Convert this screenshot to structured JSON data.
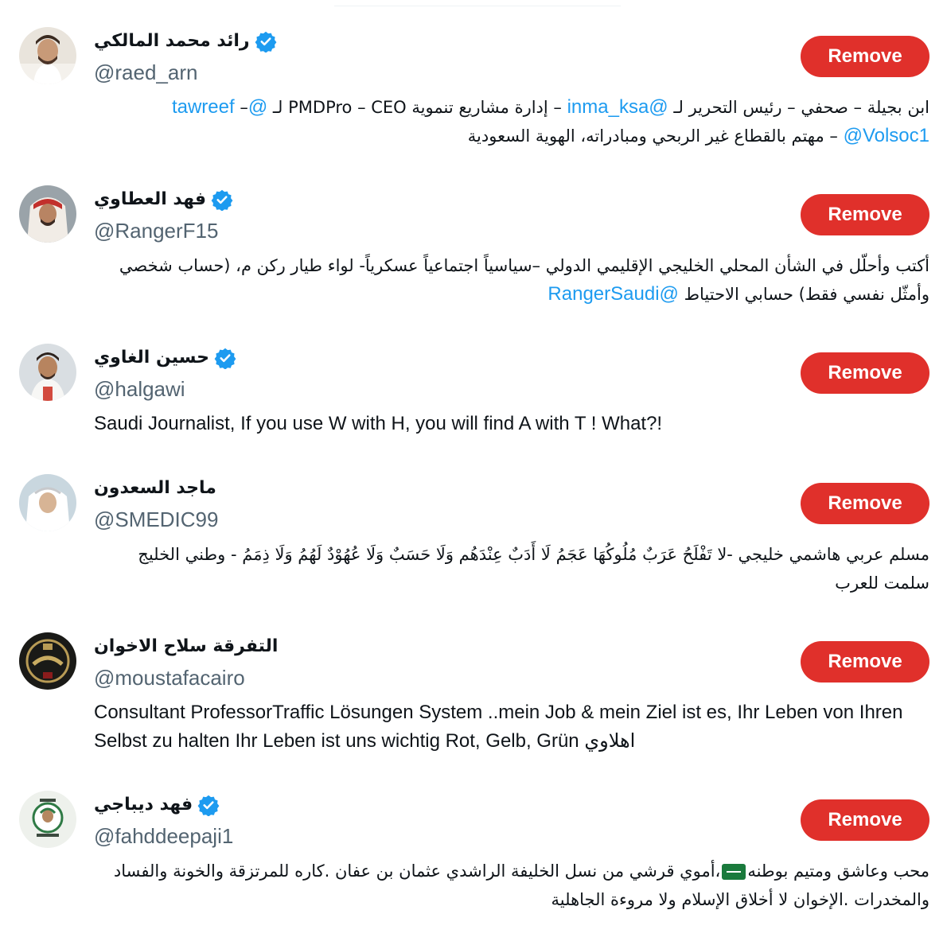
{
  "colors": {
    "remove_bg": "#e0302b",
    "mention": "#1d9bf0",
    "handle": "#536471",
    "verified": "#1d9bf0"
  },
  "users": [
    {
      "name": "رائد محمد المالكي",
      "verified": true,
      "handle": "@raed_arn",
      "remove_label": "Remove",
      "bio_dir": "rtl",
      "bio_parts": [
        {
          "t": "ابن بجيلة – صحفي – رئيس التحرير لـ "
        },
        {
          "t": "@inma_ksa",
          "m": true
        },
        {
          "t": " – إدارة مشاريع تنموية PMDPro – CEO لـ "
        },
        {
          "t": "@tawreef",
          "m": true
        },
        {
          "t": " – "
        },
        {
          "t": "@Volsoc1",
          "m": true
        },
        {
          "t": " – مهتم بالقطاع غير الربحي ومبادراته، الهوية السعودية"
        }
      ]
    },
    {
      "name": "فهد العطاوي",
      "verified": true,
      "handle": "@RangerF15",
      "remove_label": "Remove",
      "bio_dir": "rtl",
      "bio_parts": [
        {
          "t": "أكتب وأحلّل في الشأن المحلي الخليجي الإقليمي الدولي –سياسياً اجتماعياً عسكرياً- لواء طيار ركن م، (حساب شخصي وأمثّل نفسي فقط) حسابي الاحتياط "
        },
        {
          "t": "@RangerSaudi",
          "m": true
        }
      ]
    },
    {
      "name": "حسين الغاوي",
      "verified": true,
      "handle": "@halgawi",
      "remove_label": "Remove",
      "bio_dir": "ltr",
      "bio_parts": [
        {
          "t": "Saudi Journalist, If you use W with H, you will find A with T ! What?!"
        }
      ]
    },
    {
      "name": "ماجد السعدون",
      "verified": false,
      "handle": "@SMEDIC99",
      "remove_label": "Remove",
      "bio_dir": "rtl",
      "bio_parts": [
        {
          "t": "مسلم عربي هاشمي خليجي -لا تَفْلَحُ عَرَبٌ مُلُوكُهَا عَجَمُ لَا أَدَبٌ عِنْدَهُم وَلَا حَسَبٌ وَلَا عُهُوْدٌ لَهُمُ وَلَا ذِمَمُ - وطني الخليج سلمت للعرب"
        }
      ]
    },
    {
      "name": "التفرقة سلاح الاخوان",
      "verified": false,
      "handle": "@moustafacairo",
      "remove_label": "Remove",
      "bio_dir": "ltr",
      "bio_parts": [
        {
          "t": "Consultant ProfessorTraffic Lösungen System ..mein Job & mein Ziel ist es, Ihr Leben von Ihren Selbst zu halten Ihr Leben ist uns wichtig Rot, Gelb, Grün اهلاوي"
        }
      ]
    },
    {
      "name": "فهد ديباجي",
      "verified": true,
      "handle": "@fahddeepaji1",
      "remove_label": "Remove",
      "bio_dir": "rtl",
      "bio_parts": [
        {
          "t": "محب وعاشق ومتيم بوطنه"
        },
        {
          "flag": true
        },
        {
          "t": "،أموي قرشي من نسل الخليفة الراشدي عثمان بن عفان .كاره للمرتزقة والخونة والفساد والمخدرات .الإخوان لا أخلاق الإسلام ولا مروءة الجاهلية"
        }
      ]
    }
  ]
}
